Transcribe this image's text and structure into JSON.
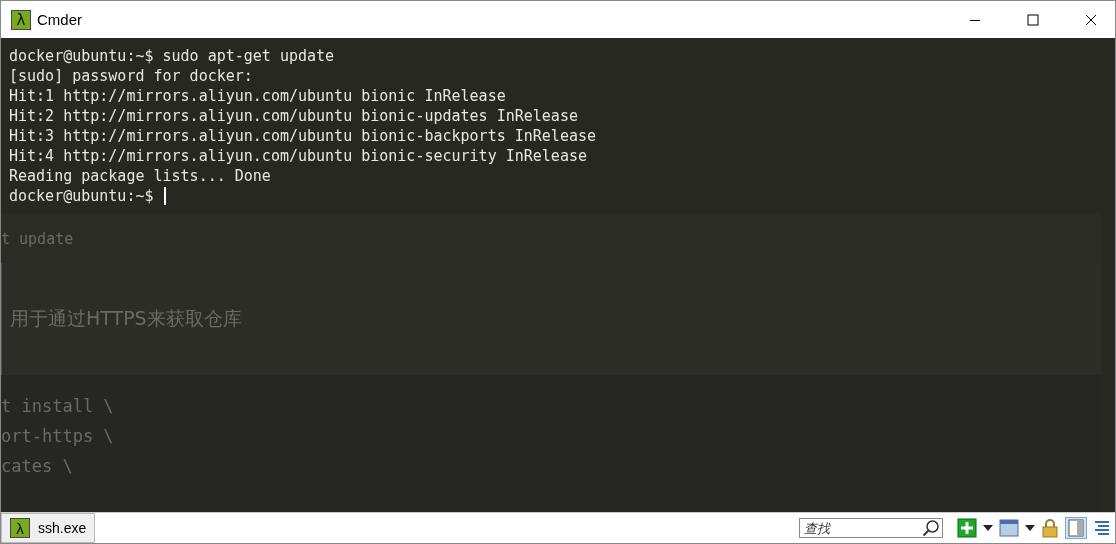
{
  "window": {
    "icon": "λ",
    "title": "Cmder"
  },
  "terminal": {
    "lines": [
      "docker@ubuntu:~$ sudo apt-get update",
      "[sudo] password for docker:",
      "Hit:1 http://mirrors.aliyun.com/ubuntu bionic InRelease",
      "Hit:2 http://mirrors.aliyun.com/ubuntu bionic-updates InRelease",
      "Hit:3 http://mirrors.aliyun.com/ubuntu bionic-backports InRelease",
      "Hit:4 http://mirrors.aliyun.com/ubuntu bionic-security InRelease",
      "Reading package lists... Done",
      "docker@ubuntu:~$ "
    ],
    "background_page": {
      "code_1": [
        "t update"
      ],
      "note": "用于通过HTTPS来获取仓库",
      "code_2": [
        "t install \\",
        "ort-https \\",
        "cates \\"
      ]
    }
  },
  "status_bar": {
    "tab": {
      "icon": "λ",
      "label": "ssh.exe",
      "selected": true
    },
    "search": {
      "placeholder": "查找"
    }
  }
}
